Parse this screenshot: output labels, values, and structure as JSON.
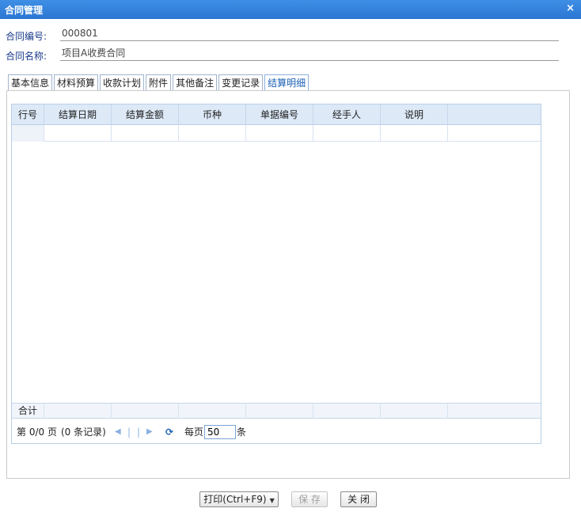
{
  "window": {
    "title": "合同管理",
    "close_glyph": "×"
  },
  "form": {
    "contract_no_label": "合同编号:",
    "contract_no_value": "000801",
    "contract_name_label": "合同名称:",
    "contract_name_value": "项目A收费合同"
  },
  "tabs": [
    {
      "label": "基本信息"
    },
    {
      "label": "材料预算"
    },
    {
      "label": "收款计划"
    },
    {
      "label": "附件"
    },
    {
      "label": "其他备注"
    },
    {
      "label": "变更记录"
    },
    {
      "label": "结算明细",
      "active": true
    }
  ],
  "grid": {
    "columns": [
      "行号",
      "结算日期",
      "结算金额",
      "币种",
      "单据编号",
      "经手人",
      "说明"
    ],
    "rows": [],
    "total_label": "合计"
  },
  "pager": {
    "page_info": "第  0/0 页",
    "record_info": "(0 条记录)",
    "per_page_label": "每页",
    "per_page_value": "50",
    "per_page_unit": "条",
    "first_glyph": "◀",
    "sep1": "|",
    "sep2": "|",
    "next_glyph": "▶",
    "refresh_glyph": "⟳"
  },
  "buttons": {
    "print_label": "打印(Ctrl+F9)",
    "save_label": "保 存",
    "close_label": "关 闭",
    "dropdown_glyph": "▼"
  },
  "colors": {
    "titlebar": "#2a76d2",
    "label_text": "#1a3a8a",
    "active_tab": "#1a5fb4",
    "grid_header": "#dde9f7"
  }
}
